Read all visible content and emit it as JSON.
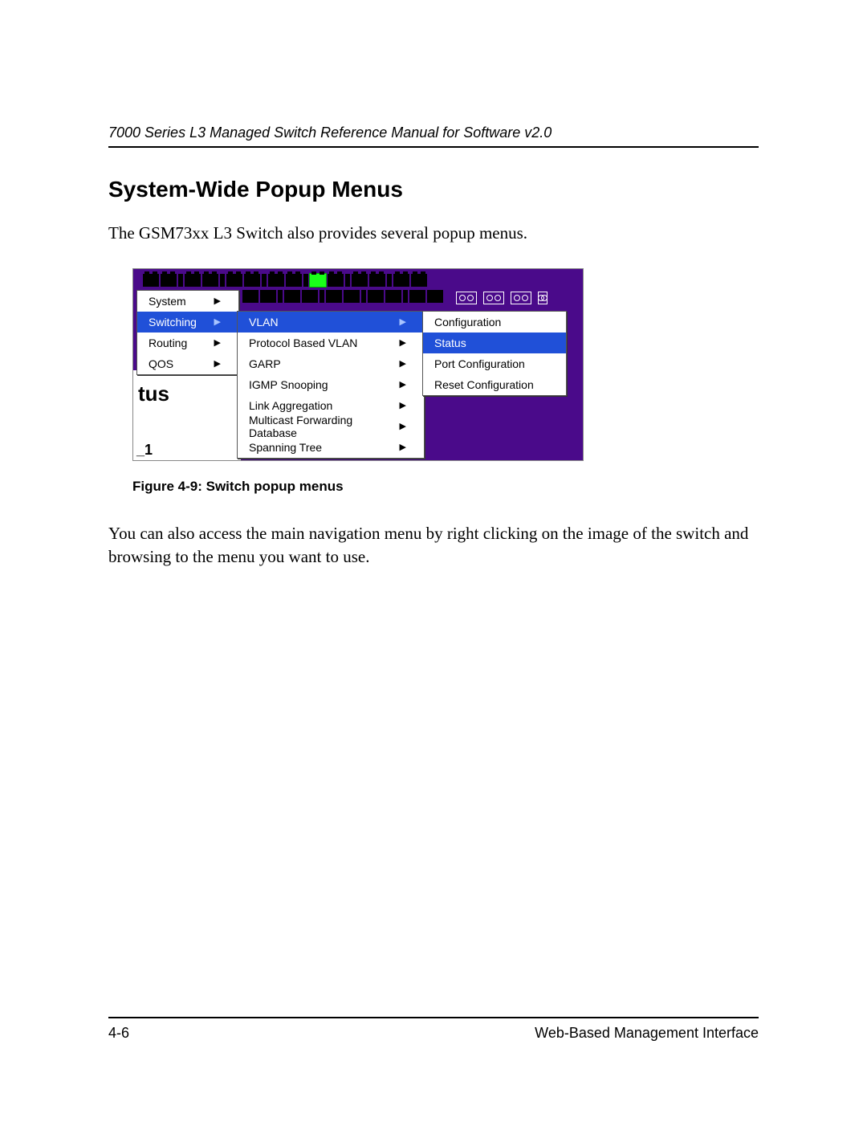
{
  "header": "7000 Series L3 Managed Switch Reference Manual for Software v2.0",
  "section_title": "System-Wide Popup Menus",
  "intro_paragraph": "The GSM73xx L3 Switch also provides several popup menus.",
  "figure_caption": "Figure 4-9:  Switch popup menus",
  "post_paragraph": "You can also access the main navigation menu by right clicking on the image of the switch and browsing to the menu you want to use.",
  "footer": {
    "page": "4-6",
    "section": "Web-Based Management Interface"
  },
  "ui": {
    "menu1": {
      "items": [
        {
          "label": "System",
          "highlight": false,
          "arrow": true
        },
        {
          "label": "Switching",
          "highlight": true,
          "arrow": true
        },
        {
          "label": "Routing",
          "highlight": false,
          "arrow": true
        },
        {
          "label": "QOS",
          "highlight": false,
          "arrow": true
        }
      ]
    },
    "menu2": {
      "items": [
        {
          "label": "VLAN",
          "highlight": true,
          "arrow": true
        },
        {
          "label": "Protocol Based VLAN",
          "highlight": false,
          "arrow": true
        },
        {
          "label": "GARP",
          "highlight": false,
          "arrow": true
        },
        {
          "label": "IGMP Snooping",
          "highlight": false,
          "arrow": true
        },
        {
          "label": "Link Aggregation",
          "highlight": false,
          "arrow": true
        },
        {
          "label": "Multicast Forwarding Database",
          "highlight": false,
          "arrow": true
        },
        {
          "label": "Spanning Tree",
          "highlight": false,
          "arrow": true
        }
      ]
    },
    "menu3": {
      "items": [
        {
          "label": "Configuration",
          "highlight": false,
          "arrow": false
        },
        {
          "label": "Status",
          "highlight": true,
          "arrow": false
        },
        {
          "label": "Port Configuration",
          "highlight": false,
          "arrow": false
        },
        {
          "label": "Reset Configuration",
          "highlight": false,
          "arrow": false
        }
      ]
    },
    "bg_text": "tus",
    "bg_corner": "_1"
  }
}
